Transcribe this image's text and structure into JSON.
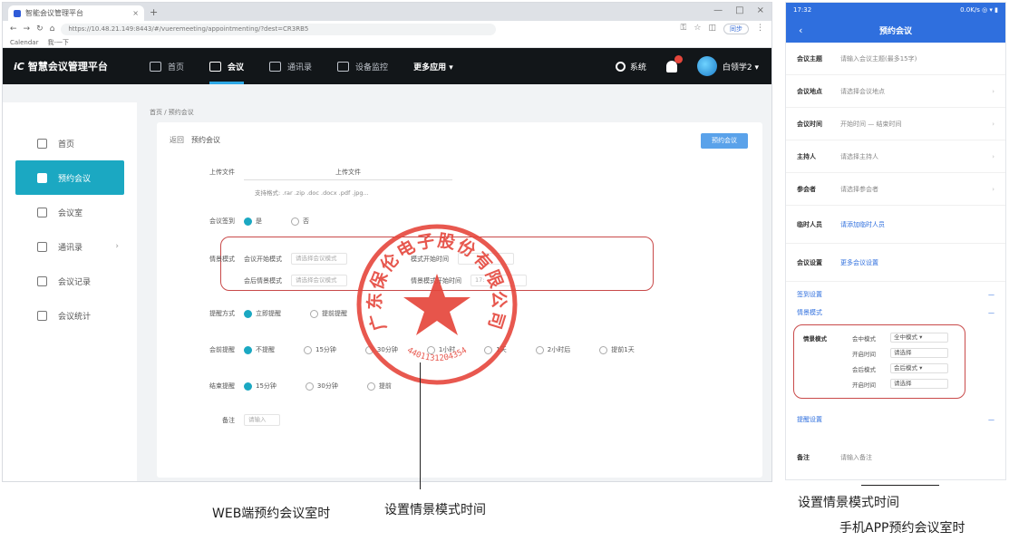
{
  "browser": {
    "tab_title": "智能会议管理平台",
    "url": "https://10.48.21.149:8443/#/vueremeeting/appointmenting/?dest=CR3RB5",
    "sync_label": "同步",
    "bookmarks": [
      "Calendar",
      "我-一下"
    ]
  },
  "header": {
    "logo_mark": "iC",
    "app_name": "智慧会议管理平台",
    "nav": [
      {
        "label": "首页",
        "active": false
      },
      {
        "label": "会议",
        "active": true
      },
      {
        "label": "通讯录",
        "active": false
      },
      {
        "label": "设备监控",
        "active": false
      }
    ],
    "more_apps": "更多应用 ▾",
    "system": "系统",
    "username": "白领学2 ▾"
  },
  "breadcrumb": "首页 / 预约会议",
  "sidebar": [
    {
      "label": "首页",
      "active": false
    },
    {
      "label": "预约会议",
      "active": true
    },
    {
      "label": "会议室",
      "active": false
    },
    {
      "label": "通讯录",
      "active": false,
      "has_arrow": true
    },
    {
      "label": "会议记录",
      "active": false
    },
    {
      "label": "会议统计",
      "active": false
    }
  ],
  "form": {
    "back_label": "返回",
    "title": "预约会议",
    "submit_label": "预约会议",
    "upload_label": "上传文件",
    "upload_button": "上传文件",
    "upload_hint": "支持格式: .rar .zip .doc .docx .pdf .jpg...",
    "meeting_type_label": "会议签到",
    "meeting_type_options": [
      "是",
      "否"
    ],
    "scene_label": "情景模式",
    "scene_rows": [
      {
        "name": "会议开始模式",
        "placeholder": "请选择会议模式",
        "time_label": "模式开始时间",
        "time_value": ""
      },
      {
        "name": "会后情景模式",
        "placeholder": "请选择会议模式",
        "time_label": "情景模式开始时间",
        "time_value": "17:"
      }
    ],
    "remind_label": "提醒方式",
    "remind_options": [
      "立即提醒",
      "提前提醒"
    ],
    "meeting_remind_label": "会前提醒",
    "meeting_remind_options": [
      "不提醒",
      "15分钟",
      "30分钟",
      "1小时",
      "1天",
      "2小时后",
      "提前1天"
    ],
    "end_remind_label": "结束提醒",
    "end_remind_options": [
      "15分钟",
      "30分钟",
      "提前"
    ],
    "note_label": "备注",
    "note_placeholder": "请输入"
  },
  "stamp": {
    "company": "广东保伦电子股份有限公司",
    "serial": "4401131204354"
  },
  "captions": {
    "web": "WEB端预约会议室时",
    "web_scene": "设置情景模式时间",
    "mobile_scene": "设置情景模式时间",
    "mobile": "手机APP预约会议室时"
  },
  "phone": {
    "time": "17:32",
    "status_right": "0.0K/s ◎ ▾ ▮",
    "title": "预约会议",
    "rows": [
      {
        "key": "会议主题",
        "value": "请输入会议主题(最多15字)",
        "link": false
      },
      {
        "key": "会议地点",
        "value": "请选择会议地点",
        "link": false
      },
      {
        "key": "会议时间",
        "value": "开始时间 — 结束时间",
        "link": false
      },
      {
        "key": "主持人",
        "value": "请选择主持人",
        "link": false
      },
      {
        "key": "参会者",
        "value": "请选择参会者",
        "link": false
      },
      {
        "key": "临时人员",
        "value": "请添加临时人员",
        "link": true
      },
      {
        "key": "会议设置",
        "value": "更多会议设置",
        "link": true
      }
    ],
    "section_1": "签到设置",
    "section_2": "情景模式",
    "scene_key": "情景模式",
    "scene_grid": [
      [
        "会中模式",
        "会中模式",
        "全中模式 ▾"
      ],
      [
        "",
        "开启时间",
        "请选择"
      ],
      [
        "",
        "会后模式",
        "会后模式 ▾"
      ],
      [
        "",
        "开启时间",
        "请选择"
      ]
    ],
    "section_3": "提醒设置",
    "note_key": "备注",
    "note_value": "请输入备注"
  },
  "colors": {
    "header_bg": "#121619",
    "accent": "#1ba8c2",
    "stamp_red": "#e5463c",
    "mobile_blue": "#2f6fde"
  }
}
